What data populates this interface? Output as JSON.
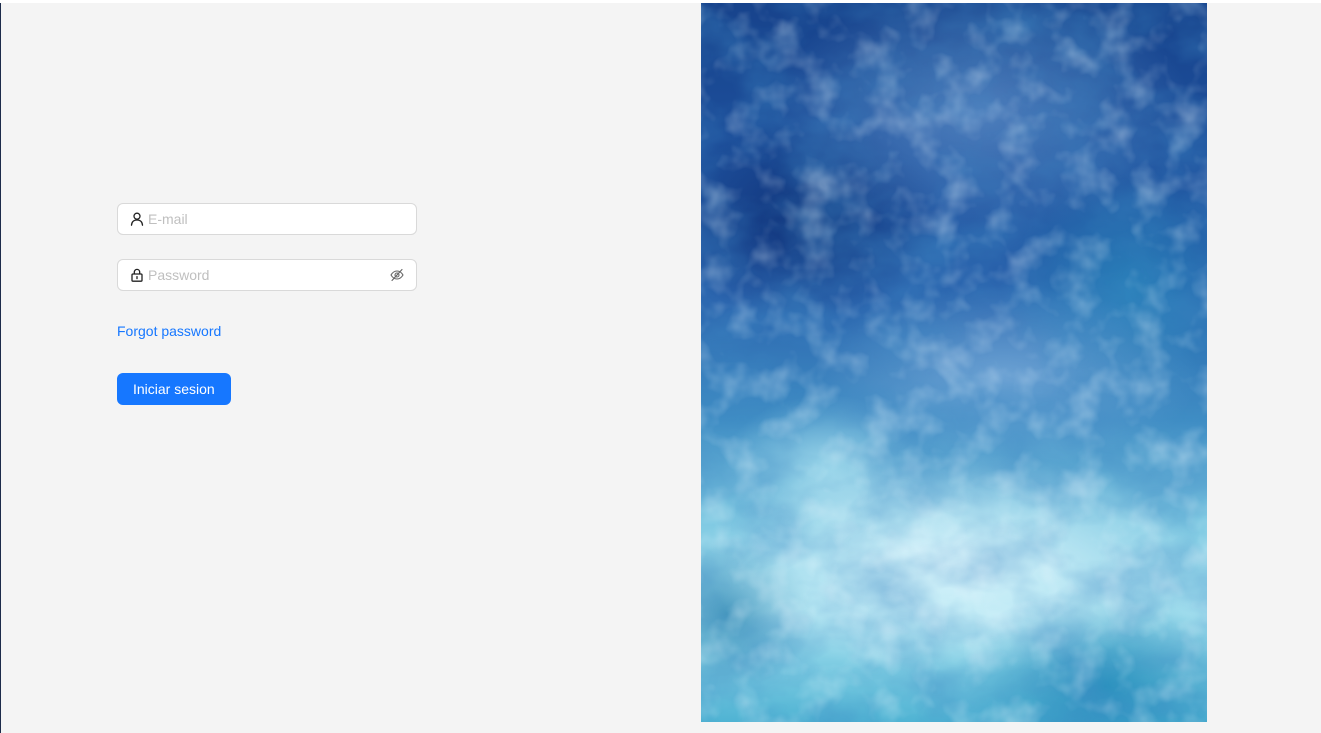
{
  "login": {
    "email": {
      "placeholder": "E-mail",
      "value": "",
      "icon": "user-icon"
    },
    "password": {
      "placeholder": "Password",
      "value": "",
      "icon": "lock-icon",
      "toggle_icon": "eye-invisible-icon"
    },
    "forgot_password_label": "Forgot password",
    "submit_label": "Iniciar sesion"
  },
  "colors": {
    "background": "#f4f4f4",
    "primary": "#1677ff",
    "border": "#d9d9d9",
    "placeholder": "#bfbfbf"
  },
  "hero": {
    "description_icon": "watercolor-texture-image"
  }
}
